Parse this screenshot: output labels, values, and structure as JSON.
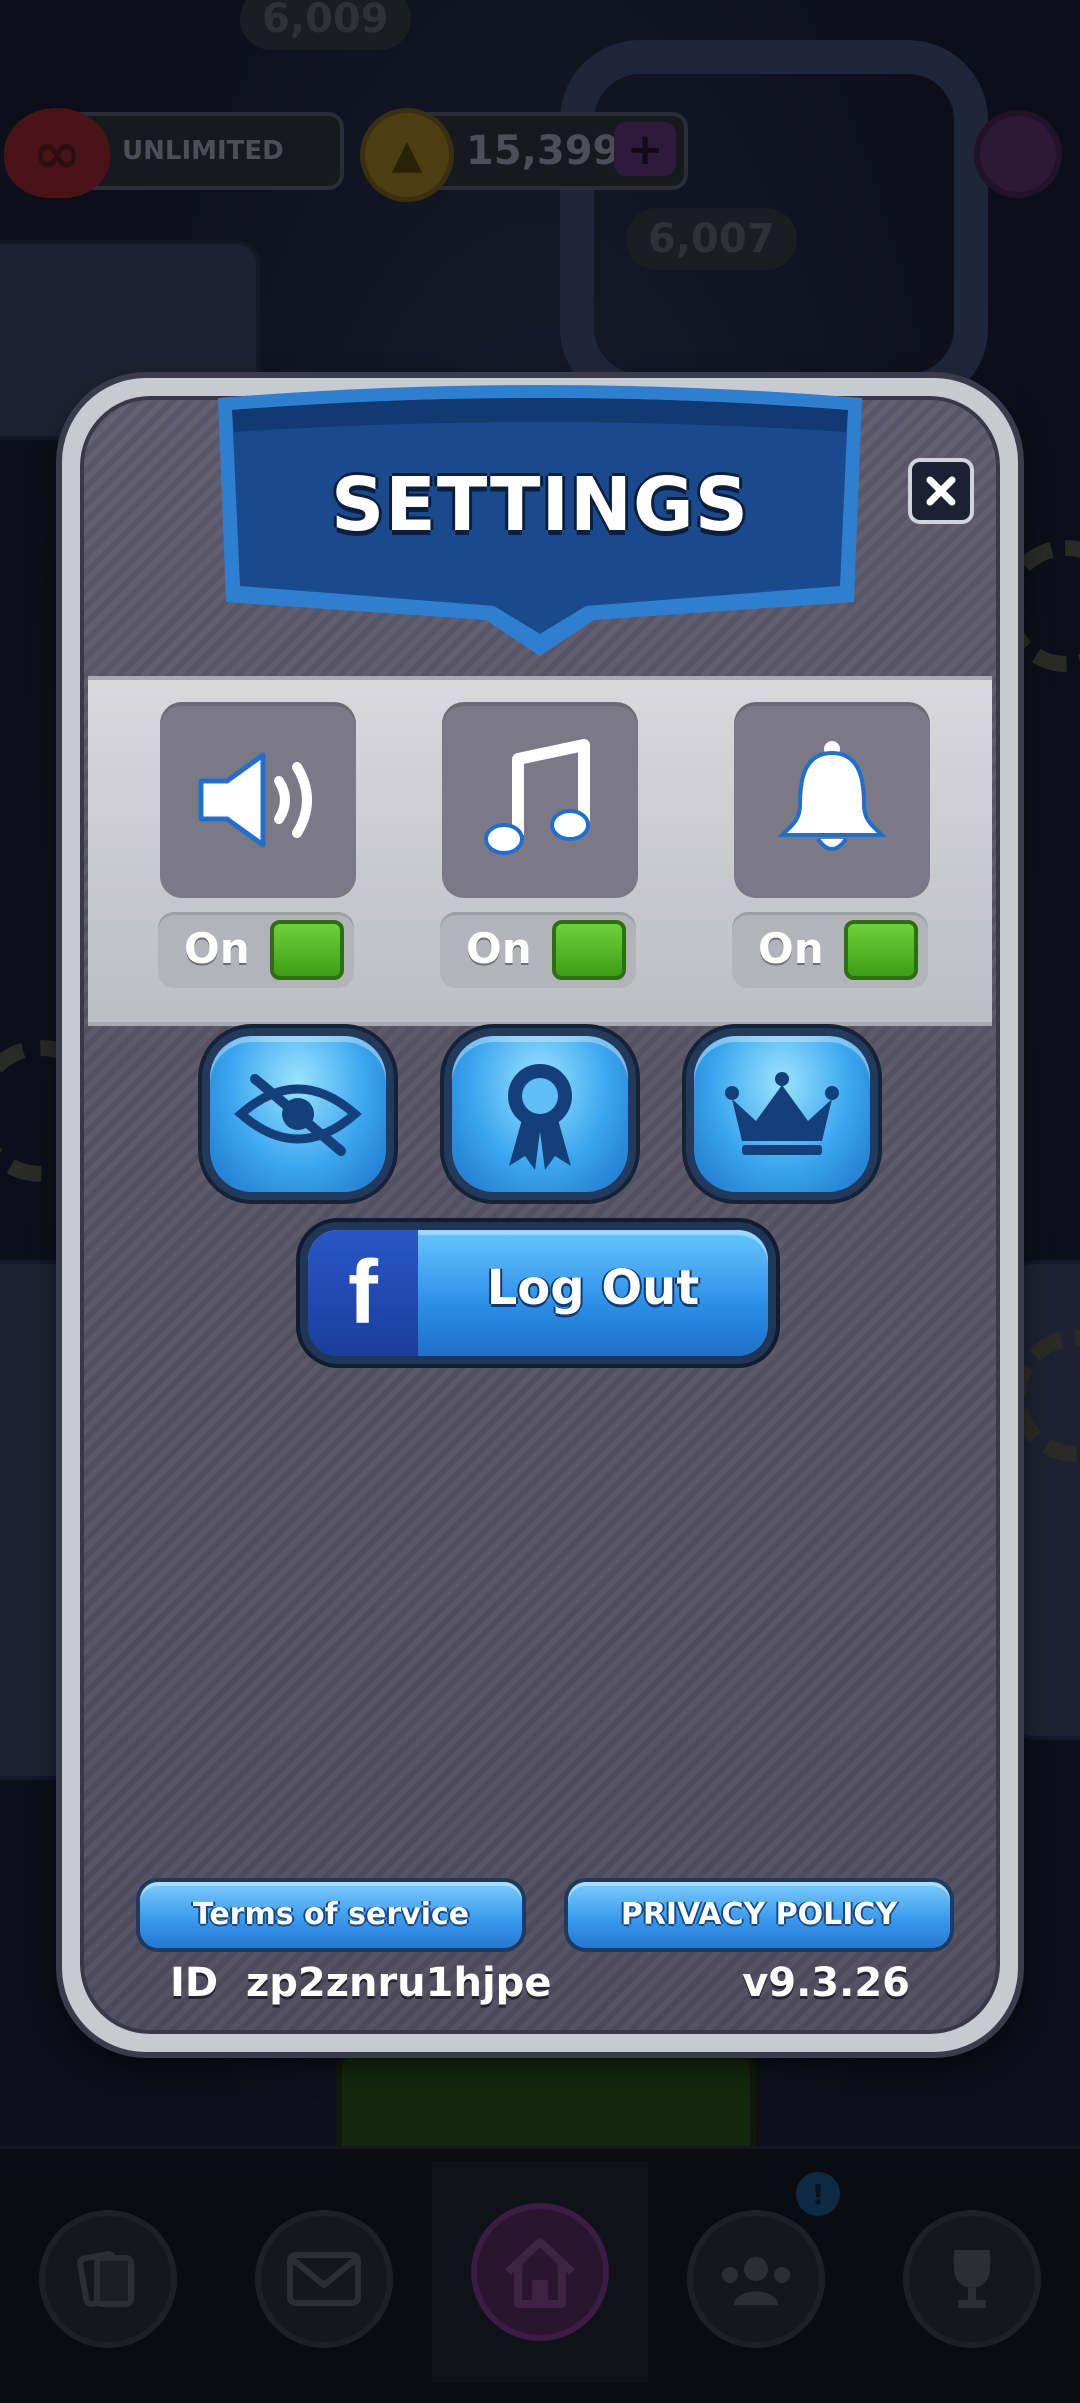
{
  "background": {
    "lives_label": "UNLIMITED",
    "lives_icon": "infinity-heart-icon",
    "coins": "15,399",
    "coin_icon": "coin-icon",
    "plus_label": "+",
    "score_top": "6,009",
    "score_mid": "6,007"
  },
  "settings": {
    "title": "SETTINGS",
    "close_label": "✕",
    "toggles": [
      {
        "icon": "sound-icon",
        "label": "On",
        "state": "on"
      },
      {
        "icon": "music-icon",
        "label": "On",
        "state": "on"
      },
      {
        "icon": "notification-bell-icon",
        "label": "On",
        "state": "on"
      }
    ],
    "icon_buttons": [
      "privacy-hide-icon",
      "award-ribbon-icon",
      "crown-icon"
    ],
    "logout": {
      "fb_letter": "f",
      "label": "Log Out"
    },
    "terms_label": "Terms of service",
    "privacy_label": "PRIVACY POLICY",
    "id_label": "ID",
    "id_value": "zp2znru1hjpe",
    "version": "v9.3.26"
  },
  "bottom_nav": {
    "items": [
      "cards-icon",
      "mail-icon",
      "home-icon",
      "friends-icon",
      "trophy-icon"
    ],
    "active": "home-icon",
    "friends_badge": "!"
  },
  "colors": {
    "accent_blue": "#3aa6ef",
    "ribbon_blue": "#1c4f96",
    "toggle_green": "#4fb823"
  }
}
